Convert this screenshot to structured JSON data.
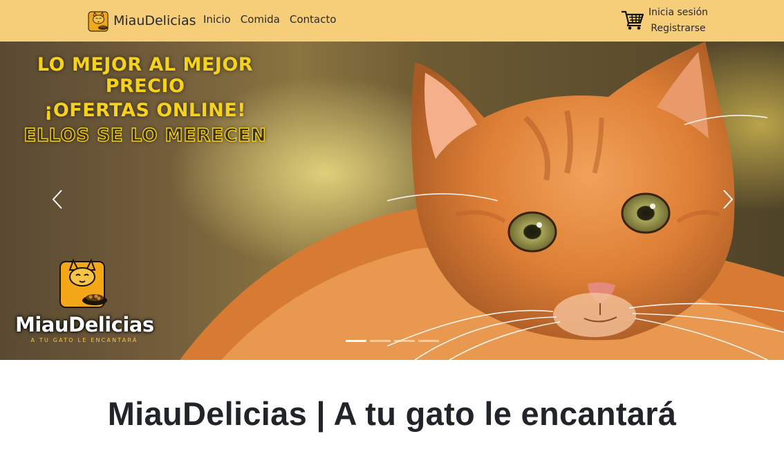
{
  "navbar": {
    "brand": "MiauDelicias",
    "links": [
      "Inicio",
      "Comida",
      "Contacto"
    ],
    "login": "Inicia sesión",
    "register": "Registrarse",
    "background_color": "#f6cd79"
  },
  "carousel": {
    "promo_line1": "LO MEJOR AL MEJOR PRECIO",
    "promo_line2": "¡OFERTAS ONLINE!",
    "promo_line3": "ELLOS SE LO MERECEN",
    "logo_name": "MiauDelicias",
    "logo_tagline": "A TU GATO LE ENCANTARÁ",
    "slide_count": 4,
    "active_slide": 1,
    "accent_color": "#f7d21b"
  },
  "icons": {
    "brand": "cat-food-bag-icon",
    "cart": "shopping-cart-icon",
    "prev": "chevron-left-icon",
    "next": "chevron-right-icon"
  },
  "main": {
    "heading": "MiauDelicias | A tu gato le encantará"
  }
}
